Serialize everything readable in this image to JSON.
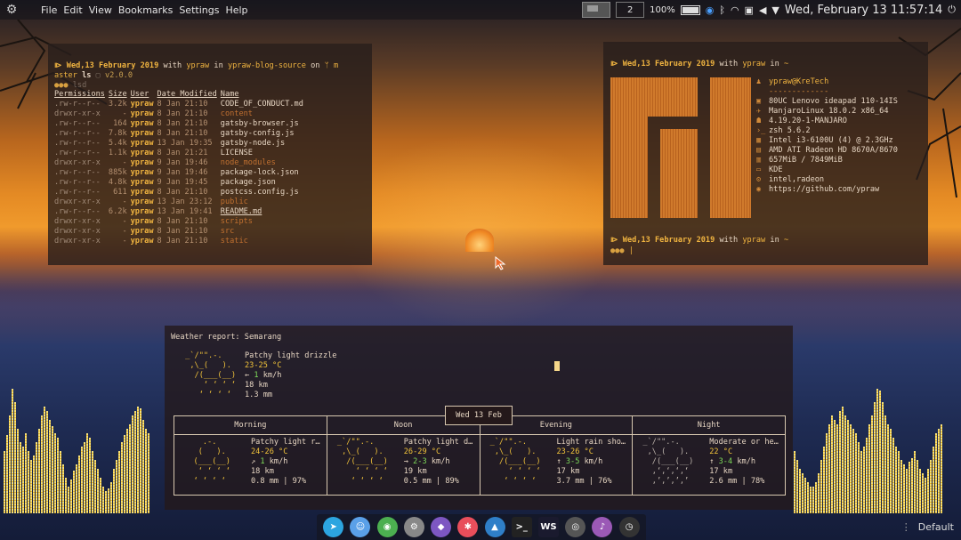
{
  "menubar": {
    "items": [
      "File",
      "Edit",
      "View",
      "Bookmarks",
      "Settings",
      "Help"
    ],
    "desktop_number": "2",
    "battery_percent": "100%",
    "datetime": "Wed, February 13  11:57:14"
  },
  "terminal_left": {
    "prompt_date": "Wed,13 February 2019",
    "with_label": "with",
    "user": "ypraw",
    "in_label": "in",
    "dir": "ypraw-blog-source",
    "on_label": "on",
    "branch_prefix": "m",
    "branch_rest": "aster",
    "command": "ls",
    "version": "v2.0.0",
    "lsd_prompt": "lsd",
    "headers": [
      "Permissions",
      "Size",
      "User",
      "Date Modified",
      "Name"
    ],
    "rows": [
      {
        "perm": ".rw-r--r--",
        "size": "3.2k",
        "user": "ypraw",
        "date": "8 Jan 21:10",
        "name": "CODE_OF_CONDUCT.md",
        "dir": false
      },
      {
        "perm": "drwxr-xr-x",
        "size": "-",
        "user": "ypraw",
        "date": "8 Jan 21:10",
        "name": "content",
        "dir": true
      },
      {
        "perm": ".rw-r--r--",
        "size": "164",
        "user": "ypraw",
        "date": "8 Jan 21:10",
        "name": "gatsby-browser.js",
        "dir": false
      },
      {
        "perm": ".rw-r--r--",
        "size": "7.8k",
        "user": "ypraw",
        "date": "8 Jan 21:10",
        "name": "gatsby-config.js",
        "dir": false
      },
      {
        "perm": ".rw-r--r--",
        "size": "5.4k",
        "user": "ypraw",
        "date": "13 Jan 19:35",
        "name": "gatsby-node.js",
        "dir": false
      },
      {
        "perm": ".rw-r--r--",
        "size": "1.1k",
        "user": "ypraw",
        "date": "8 Jan 21:21",
        "name": "LICENSE",
        "dir": false
      },
      {
        "perm": "drwxr-xr-x",
        "size": "-",
        "user": "ypraw",
        "date": "9 Jan 19:46",
        "name": "node_modules",
        "dir": true
      },
      {
        "perm": ".rw-r--r--",
        "size": "885k",
        "user": "ypraw",
        "date": "9 Jan 19:46",
        "name": "package-lock.json",
        "dir": false
      },
      {
        "perm": ".rw-r--r--",
        "size": "4.8k",
        "user": "ypraw",
        "date": "9 Jan 19:45",
        "name": "package.json",
        "dir": false
      },
      {
        "perm": ".rw-r--r--",
        "size": "611",
        "user": "ypraw",
        "date": "8 Jan 21:10",
        "name": "postcss.config.js",
        "dir": false
      },
      {
        "perm": "drwxr-xr-x",
        "size": "-",
        "user": "ypraw",
        "date": "13 Jan 23:12",
        "name": "public",
        "dir": true
      },
      {
        "perm": ".rw-r--r--",
        "size": "6.2k",
        "user": "ypraw",
        "date": "13 Jan 19:41",
        "name": "README.md",
        "dir": false
      },
      {
        "perm": "drwxr-xr-x",
        "size": "-",
        "user": "ypraw",
        "date": "8 Jan 21:10",
        "name": "scripts",
        "dir": true
      },
      {
        "perm": "drwxr-xr-x",
        "size": "-",
        "user": "ypraw",
        "date": "8 Jan 21:10",
        "name": "src",
        "dir": true
      },
      {
        "perm": "drwxr-xr-x",
        "size": "-",
        "user": "ypraw",
        "date": "8 Jan 21:10",
        "name": "static",
        "dir": true
      }
    ]
  },
  "terminal_right": {
    "prompt_date": "Wed,13 February 2019",
    "with_label": "with",
    "user": "ypraw",
    "in_label": "in",
    "dir": "~",
    "userhost": "ypraw@KreTech",
    "separator": "-------------",
    "info": [
      {
        "icon": "laptop-icon",
        "glyph": "▣",
        "text": "80UC Lenovo ideapad 110-14IS"
      },
      {
        "icon": "rocket-icon",
        "glyph": "✈",
        "text": "ManjaroLinux 18.0.2 x86_64"
      },
      {
        "icon": "tux-icon",
        "glyph": "☗",
        "text": "4.19.20-1-MANJARO"
      },
      {
        "icon": "shell-icon",
        "glyph": "›_",
        "text": "zsh 5.6.2"
      },
      {
        "icon": "cpu-icon",
        "glyph": "▦",
        "text": "Intel i3-6100U (4) @ 2.3GHz"
      },
      {
        "icon": "gpu-icon",
        "glyph": "▤",
        "text": "AMD ATI Radeon HD 8670A/8670"
      },
      {
        "icon": "memory-icon",
        "glyph": "▥",
        "text": "657MiB / 7849MiB"
      },
      {
        "icon": "desktop-icon",
        "glyph": "▭",
        "text": "KDE"
      },
      {
        "icon": "driver-icon",
        "glyph": "⚙",
        "text": "intel,radeon"
      },
      {
        "icon": "github-icon",
        "glyph": "◉",
        "text": "https://github.com/ypraw"
      }
    ]
  },
  "weather": {
    "title": "Weather report: Semarang",
    "current": {
      "ascii": " _`/\"\".-.\n  ,\\_(   ).\n   /(___(__)\n     ‘ ‘ ‘ ‘\n    ‘ ‘ ‘ ‘",
      "condition": "Patchy light drizzle",
      "temp": "23-25 °C",
      "wind_arrow": "←",
      "wind_value": "1",
      "wind_unit": "km/h",
      "visibility": "18 km",
      "precip": "1.3 mm"
    },
    "date": "Wed 13 Feb",
    "periods": [
      {
        "name": "Morning",
        "ascii": "     .-.\n    (   ).\n   (___(__)\n    ‘ ‘ ‘ ‘\n   ‘ ‘ ‘ ‘",
        "condition": "Patchy light r…",
        "temp": "24-26 °C",
        "wind_arrow": "↗",
        "wind_value": "1",
        "wind_unit": "km/h",
        "visibility": "18 km",
        "precip": "0.8 mm | 97%"
      },
      {
        "name": "Noon",
        "ascii": " _`/\"\".-.\n  ,\\_(   ).\n   /(___(__)\n     ‘ ‘ ‘ ‘\n    ‘ ‘ ‘ ‘",
        "condition": "Patchy light d…",
        "temp": "26-29 °C",
        "wind_arrow": "→",
        "wind_value": "2-3",
        "wind_unit": "km/h",
        "visibility": "19 km",
        "precip": "0.5 mm | 89%"
      },
      {
        "name": "Evening",
        "ascii": " _`/\"\".-.\n  ,\\_(   ).\n   /(___(__)\n     ‘ ‘ ‘ ‘\n    ‘ ‘ ‘ ‘",
        "condition": "Light rain sho…",
        "temp": "23-26 °C",
        "wind_arrow": "↑",
        "wind_value": "3-5",
        "wind_unit": "km/h",
        "visibility": "17 km",
        "precip": "3.7 mm | 76%"
      },
      {
        "name": "Night",
        "ascii": " _`/\"\".-.\n  ,\\_(   ).\n   /(___(__)\n   ‚‘‚‘‚‘‚‘\n   ‚’‚’‚’‚’",
        "condition": "Moderate or he…",
        "temp": "22 °C",
        "wind_arrow": "↑",
        "wind_value": "3-4",
        "wind_unit": "km/h",
        "visibility": "17 km",
        "precip": "2.6 mm | 78%"
      }
    ]
  },
  "dock": {
    "apps": [
      {
        "name": "telegram-icon",
        "color": "#2ca5e0",
        "glyph": "➤"
      },
      {
        "name": "finder-icon",
        "color": "#5aa0e8",
        "glyph": "☺"
      },
      {
        "name": "chrome-icon",
        "color": "#4caf50",
        "glyph": "◉"
      },
      {
        "name": "settings-icon",
        "color": "#888888",
        "glyph": "⚙"
      },
      {
        "name": "vscode-icon",
        "color": "#7d57c2",
        "glyph": "◆"
      },
      {
        "name": "xmind-icon",
        "color": "#e84e5b",
        "glyph": "✱"
      },
      {
        "name": "inkscape-icon",
        "color": "#2f7fc8",
        "glyph": "▲"
      },
      {
        "name": "terminal-icon",
        "color": "#222222",
        "glyph": ">_"
      },
      {
        "name": "webstorm-icon",
        "color": "#1a1a2e",
        "glyph": "WS"
      },
      {
        "name": "opera-icon",
        "color": "#555555",
        "glyph": "◎"
      },
      {
        "name": "music-icon",
        "color": "#9b59b6",
        "glyph": "♪"
      },
      {
        "name": "clock-icon",
        "color": "#333333",
        "glyph": "◷"
      }
    ],
    "default_label": "Default"
  },
  "colors": {
    "accent": "#f0b440",
    "bar": "#f5e07a"
  }
}
